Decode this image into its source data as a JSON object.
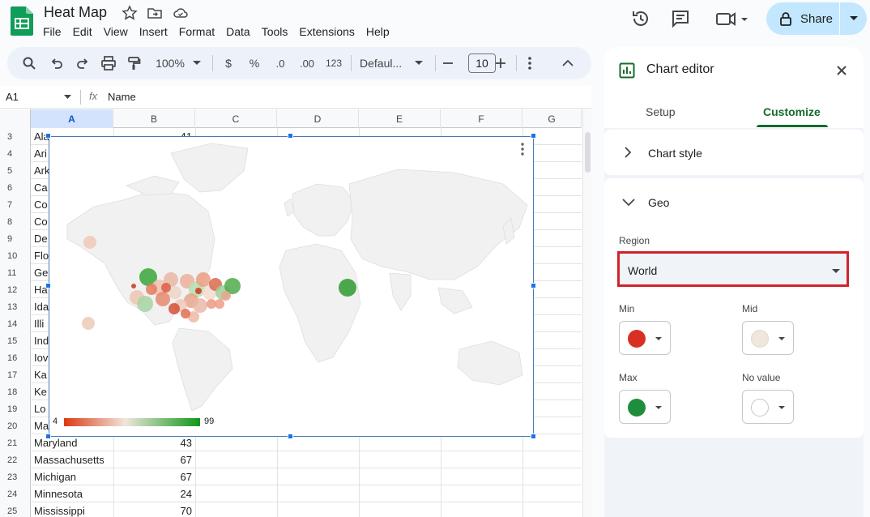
{
  "document": {
    "title": "Heat Map",
    "menu": [
      "File",
      "Edit",
      "View",
      "Insert",
      "Format",
      "Data",
      "Tools",
      "Extensions",
      "Help"
    ],
    "share_label": "Share"
  },
  "toolbar": {
    "zoom": "100%",
    "currency": "$",
    "percent": "%",
    "decrease_decimal": ".0",
    "increase_decimal": ".00",
    "number_format": "123",
    "font": "Defaul...",
    "font_size": "10"
  },
  "formula_bar": {
    "name_box": "A1",
    "fx_label": "fx",
    "value": "Name"
  },
  "grid": {
    "columns": [
      "A",
      "B",
      "C",
      "D",
      "E",
      "F",
      "G"
    ],
    "rows": [
      {
        "num": "3",
        "a": "Ala",
        "b": "41"
      },
      {
        "num": "4",
        "a": "Ari",
        "b": ""
      },
      {
        "num": "5",
        "a": "Ark",
        "b": ""
      },
      {
        "num": "6",
        "a": "Ca",
        "b": ""
      },
      {
        "num": "7",
        "a": "Co",
        "b": ""
      },
      {
        "num": "8",
        "a": "Co",
        "b": ""
      },
      {
        "num": "9",
        "a": "De",
        "b": ""
      },
      {
        "num": "10",
        "a": "Flo",
        "b": ""
      },
      {
        "num": "11",
        "a": "Ge",
        "b": ""
      },
      {
        "num": "12",
        "a": "Ha",
        "b": ""
      },
      {
        "num": "13",
        "a": "Ida",
        "b": ""
      },
      {
        "num": "14",
        "a": "Illi",
        "b": ""
      },
      {
        "num": "15",
        "a": "Ind",
        "b": ""
      },
      {
        "num": "16",
        "a": "Iov",
        "b": ""
      },
      {
        "num": "17",
        "a": "Ka",
        "b": ""
      },
      {
        "num": "18",
        "a": "Ke",
        "b": ""
      },
      {
        "num": "19",
        "a": "Lo",
        "b": ""
      },
      {
        "num": "20",
        "a": "Ma",
        "b": ""
      },
      {
        "num": "21",
        "a": "Maryland",
        "b": "43"
      },
      {
        "num": "22",
        "a": "Massachusetts",
        "b": "67"
      },
      {
        "num": "23",
        "a": "Michigan",
        "b": "67"
      },
      {
        "num": "24",
        "a": "Minnesota",
        "b": "24"
      },
      {
        "num": "25",
        "a": "Mississippi",
        "b": "70"
      }
    ]
  },
  "chart": {
    "legend_min": "4",
    "legend_max": "99",
    "colors": {
      "min": "#dc3912",
      "mid": "#efe6dc",
      "max": "#109618"
    }
  },
  "chart_editor": {
    "title": "Chart editor",
    "tabs": [
      "Setup",
      "Customize"
    ],
    "active_tab": "Customize",
    "chart_style_label": "Chart style",
    "geo_label": "Geo",
    "region_label": "Region",
    "region_value": "World",
    "min_label": "Min",
    "mid_label": "Mid",
    "max_label": "Max",
    "no_value_label": "No value",
    "swatch_colors": {
      "min": "#d93025",
      "mid": "#efe6dc",
      "max": "#1e8e3e",
      "no_value": "#ffffff"
    }
  }
}
